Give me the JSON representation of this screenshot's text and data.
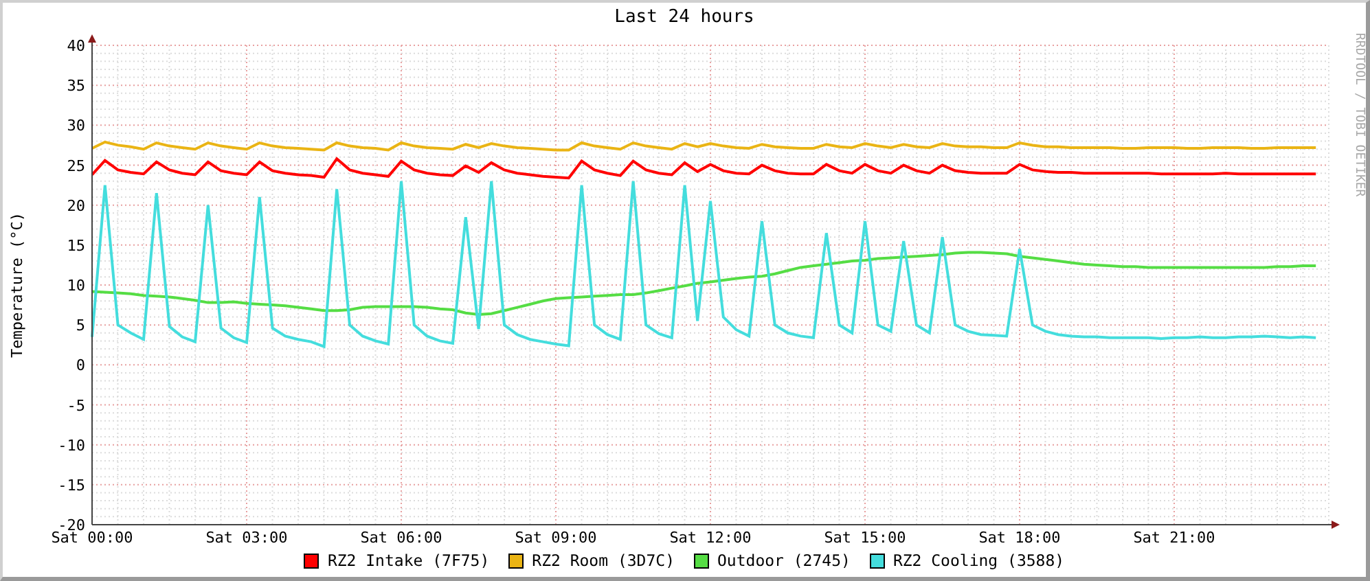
{
  "title": "Last 24 hours",
  "side_label": "RRDTOOL / TOBI OETIKER",
  "chart_data": {
    "type": "line",
    "grid": true,
    "ylabel": "Temperature (°C)",
    "ylim": [
      -20,
      40
    ],
    "yticks": [
      -20,
      -15,
      -10,
      -5,
      0,
      5,
      10,
      15,
      20,
      25,
      30,
      35,
      40
    ],
    "categories": [
      "Sat 00:00",
      null,
      null,
      null,
      null,
      null,
      null,
      null,
      null,
      null,
      null,
      null,
      "Sat 03:00",
      null,
      null,
      null,
      null,
      null,
      null,
      null,
      null,
      null,
      null,
      null,
      "Sat 06:00",
      null,
      null,
      null,
      null,
      null,
      null,
      null,
      null,
      null,
      null,
      null,
      "Sat 09:00",
      null,
      null,
      null,
      null,
      null,
      null,
      null,
      null,
      null,
      null,
      null,
      "Sat 12:00",
      null,
      null,
      null,
      null,
      null,
      null,
      null,
      null,
      null,
      null,
      null,
      "Sat 15:00",
      null,
      null,
      null,
      null,
      null,
      null,
      null,
      null,
      null,
      null,
      null,
      "Sat 18:00",
      null,
      null,
      null,
      null,
      null,
      null,
      null,
      null,
      null,
      null,
      null,
      "Sat 21:00",
      null,
      null,
      null,
      null,
      null,
      null,
      null,
      null,
      null,
      null,
      null
    ],
    "series": [
      {
        "name": "RZ2 Intake (7F75)",
        "color": "#ff0000",
        "values": [
          23.8,
          25.6,
          24.4,
          24.1,
          23.9,
          25.4,
          24.4,
          24.0,
          23.8,
          25.4,
          24.3,
          24.0,
          23.8,
          25.4,
          24.3,
          24.0,
          23.8,
          23.7,
          23.5,
          25.8,
          24.4,
          24.0,
          23.8,
          23.6,
          25.5,
          24.4,
          24.0,
          23.8,
          23.7,
          24.9,
          24.1,
          25.3,
          24.4,
          24.0,
          23.8,
          23.6,
          23.5,
          23.4,
          25.5,
          24.4,
          24.0,
          23.7,
          25.5,
          24.4,
          24.0,
          23.8,
          25.3,
          24.2,
          25.1,
          24.3,
          24.0,
          23.9,
          25.0,
          24.3,
          24.0,
          23.9,
          23.9,
          25.1,
          24.3,
          24.0,
          25.1,
          24.3,
          24.0,
          25.0,
          24.3,
          24.0,
          25.0,
          24.3,
          24.1,
          24.0,
          24.0,
          24.0,
          25.1,
          24.4,
          24.2,
          24.1,
          24.1,
          24.0,
          24.0,
          24.0,
          24.0,
          24.0,
          24.0,
          23.9,
          23.9,
          23.9,
          23.9,
          23.9,
          24.0,
          23.9,
          23.9,
          23.9,
          23.9,
          23.9,
          23.9,
          23.9
        ]
      },
      {
        "name": "RZ2 Room (3D7C)",
        "color": "#eab414",
        "values": [
          27.1,
          27.9,
          27.5,
          27.3,
          27.0,
          27.8,
          27.4,
          27.2,
          27.0,
          27.8,
          27.4,
          27.2,
          27.0,
          27.8,
          27.4,
          27.2,
          27.1,
          27.0,
          26.9,
          27.8,
          27.4,
          27.2,
          27.1,
          26.9,
          27.8,
          27.4,
          27.2,
          27.1,
          27.0,
          27.6,
          27.2,
          27.7,
          27.4,
          27.2,
          27.1,
          27.0,
          26.9,
          26.9,
          27.8,
          27.4,
          27.2,
          27.0,
          27.8,
          27.4,
          27.2,
          27.0,
          27.7,
          27.3,
          27.7,
          27.4,
          27.2,
          27.1,
          27.6,
          27.3,
          27.2,
          27.1,
          27.1,
          27.6,
          27.3,
          27.2,
          27.7,
          27.4,
          27.2,
          27.6,
          27.3,
          27.2,
          27.7,
          27.4,
          27.3,
          27.3,
          27.2,
          27.2,
          27.8,
          27.5,
          27.3,
          27.3,
          27.2,
          27.2,
          27.2,
          27.2,
          27.1,
          27.1,
          27.2,
          27.2,
          27.2,
          27.1,
          27.1,
          27.2,
          27.2,
          27.2,
          27.1,
          27.1,
          27.2,
          27.2,
          27.2,
          27.2
        ]
      },
      {
        "name": "Outdoor (2745)",
        "color": "#55dd44",
        "values": [
          9.2,
          9.1,
          9.0,
          8.9,
          8.7,
          8.6,
          8.5,
          8.3,
          8.1,
          7.8,
          7.8,
          7.9,
          7.7,
          7.6,
          7.5,
          7.4,
          7.2,
          7.0,
          6.8,
          6.8,
          6.9,
          7.2,
          7.3,
          7.3,
          7.3,
          7.3,
          7.2,
          7.0,
          6.9,
          6.5,
          6.3,
          6.4,
          6.8,
          7.2,
          7.6,
          8.0,
          8.3,
          8.4,
          8.5,
          8.6,
          8.7,
          8.8,
          8.8,
          9.0,
          9.3,
          9.6,
          9.9,
          10.2,
          10.4,
          10.6,
          10.8,
          11.0,
          11.1,
          11.4,
          11.8,
          12.2,
          12.4,
          12.6,
          12.8,
          13.0,
          13.1,
          13.3,
          13.4,
          13.5,
          13.6,
          13.7,
          13.8,
          14.0,
          14.1,
          14.1,
          14.0,
          13.9,
          13.6,
          13.4,
          13.2,
          13.0,
          12.8,
          12.6,
          12.5,
          12.4,
          12.3,
          12.3,
          12.2,
          12.2,
          12.2,
          12.2,
          12.2,
          12.2,
          12.2,
          12.2,
          12.2,
          12.2,
          12.3,
          12.3,
          12.4,
          12.4
        ]
      },
      {
        "name": "RZ2 Cooling (3588)",
        "color": "#44dddd",
        "values": [
          3.5,
          22.5,
          5,
          4,
          3.2,
          21.5,
          4.8,
          3.5,
          2.9,
          20,
          4.6,
          3.4,
          2.8,
          21,
          4.6,
          3.6,
          3.2,
          2.9,
          2.3,
          22,
          5,
          3.6,
          3,
          2.6,
          23,
          5,
          3.6,
          3,
          2.7,
          18.5,
          4.5,
          23,
          5,
          3.8,
          3.2,
          2.9,
          2.6,
          2.4,
          22.5,
          5,
          3.8,
          3.2,
          23,
          5,
          3.9,
          3.4,
          22.5,
          5.5,
          20.5,
          6,
          4.4,
          3.6,
          18,
          5,
          4,
          3.6,
          3.4,
          16.5,
          5,
          4,
          18,
          5,
          4.2,
          15.5,
          5,
          4,
          16,
          5,
          4.2,
          3.8,
          3.7,
          3.6,
          14.5,
          5,
          4.2,
          3.8,
          3.6,
          3.5,
          3.5,
          3.4,
          3.4,
          3.4,
          3.4,
          3.3,
          3.4,
          3.4,
          3.5,
          3.4,
          3.4,
          3.5,
          3.5,
          3.6,
          3.5,
          3.4,
          3.5,
          3.4
        ]
      }
    ]
  }
}
